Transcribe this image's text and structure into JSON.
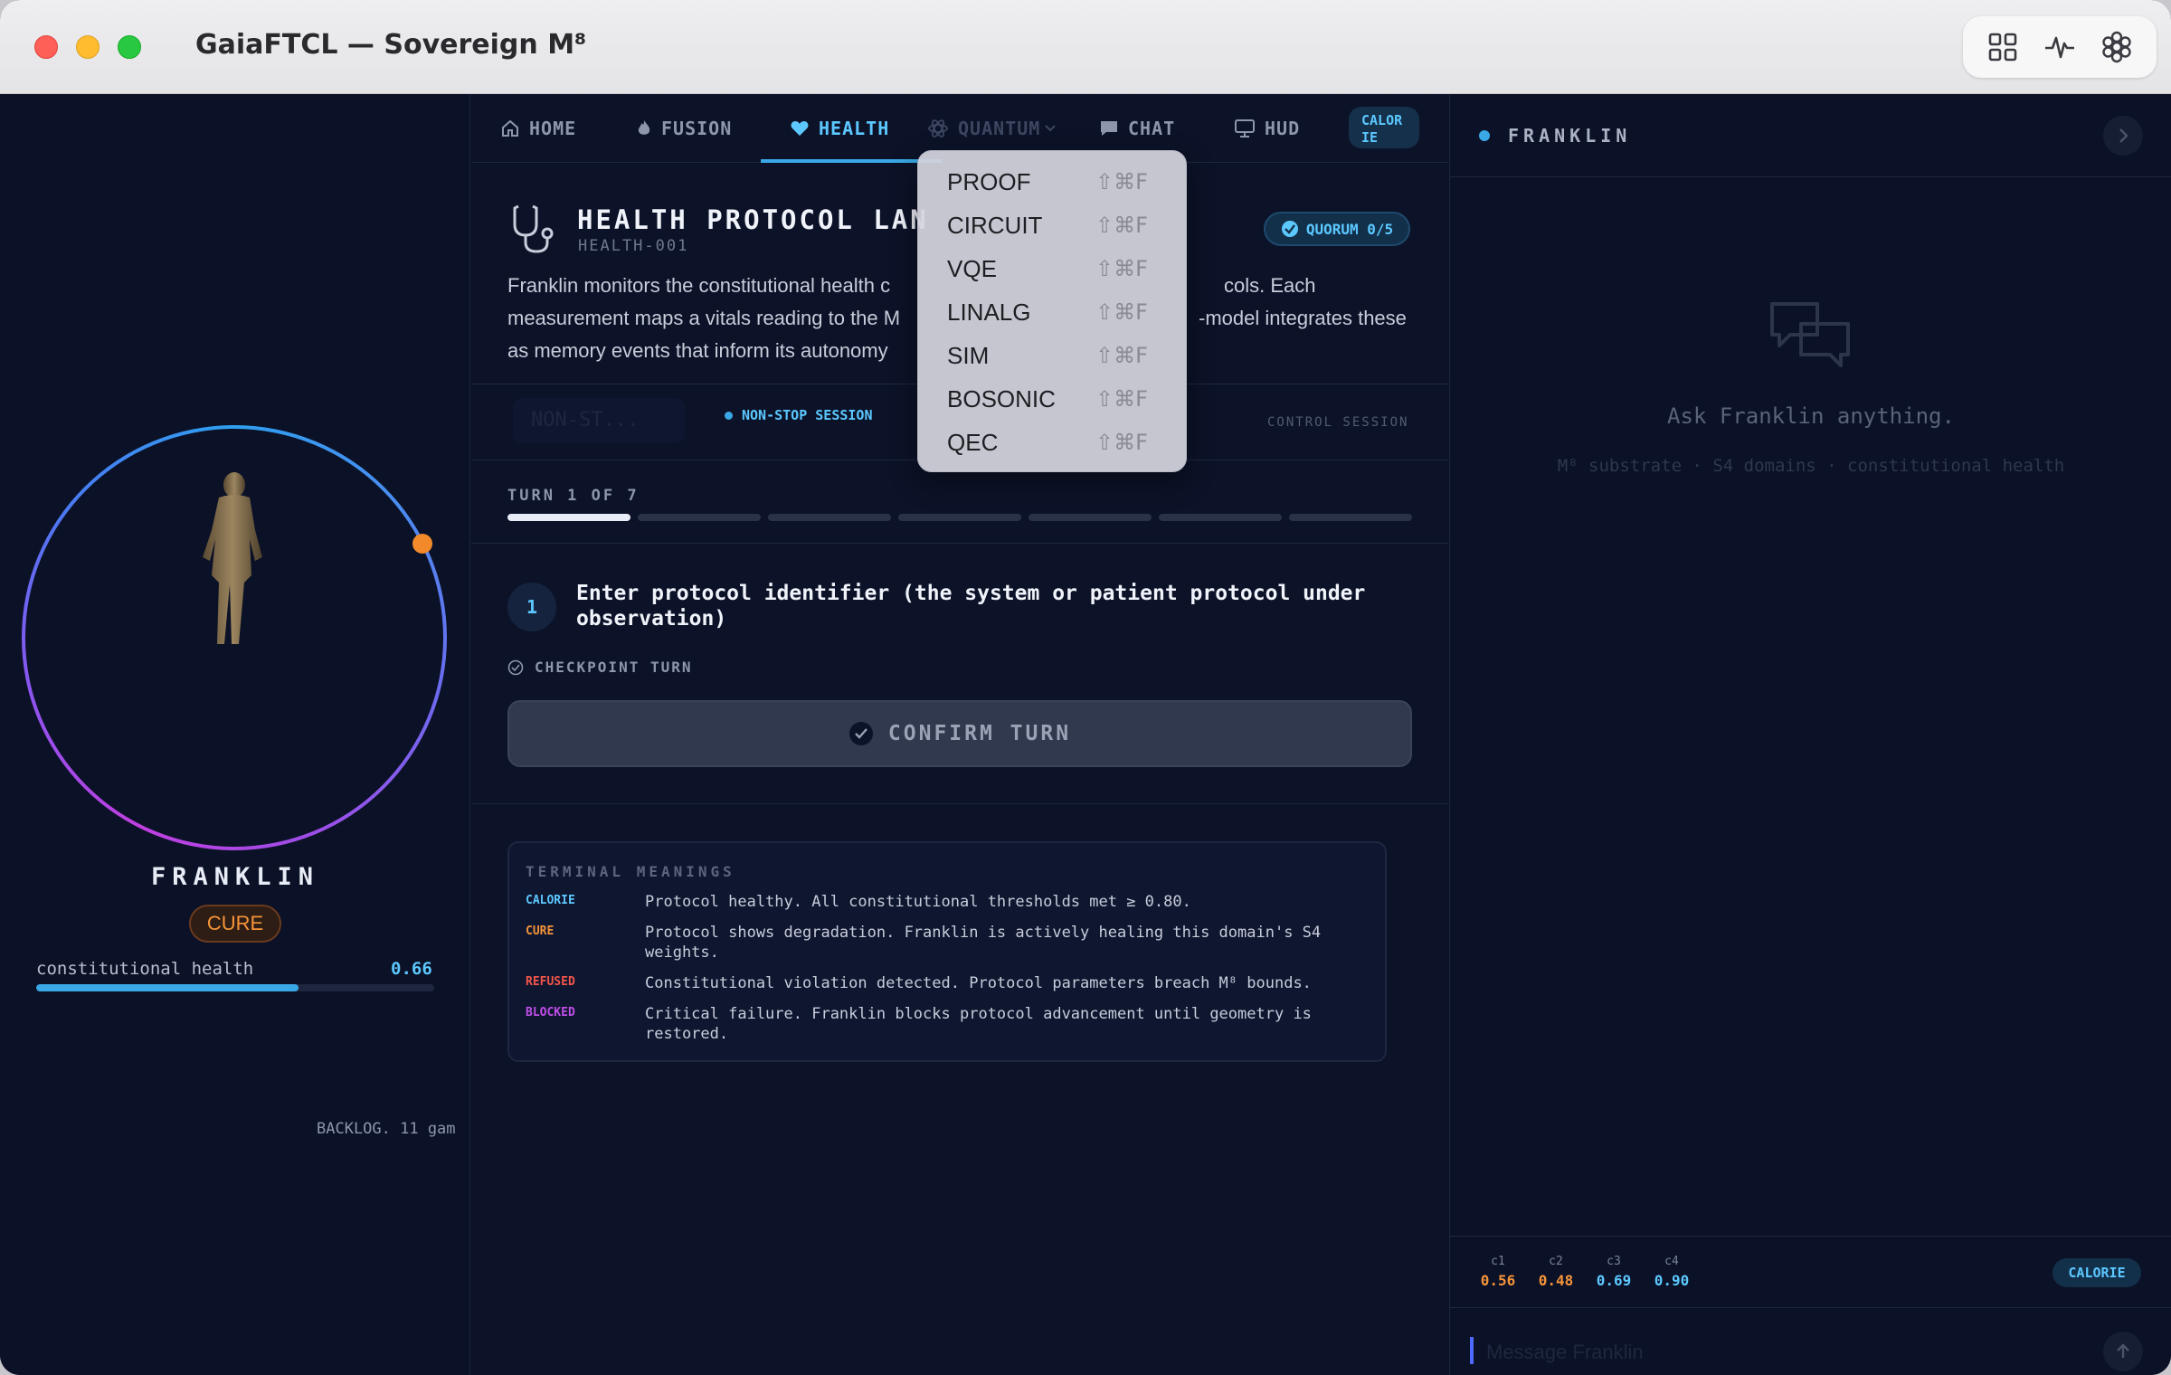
{
  "window": {
    "title": "GaiaFTCL — Sovereign M⁸",
    "toolbar_icons": [
      "grid-icon",
      "pulse-icon",
      "flower-icon"
    ]
  },
  "agent": {
    "name": "FRANKLIN",
    "status": "CURE",
    "health_label": "constitutional health",
    "health_value": "0.66",
    "health_fraction": 0.66,
    "backlog": "BACKLOG. 11 gam"
  },
  "tabs": [
    {
      "label": "HOME",
      "icon": "home-icon"
    },
    {
      "label": "FUSION",
      "icon": "flame-icon"
    },
    {
      "label": "HEALTH",
      "icon": "heart-icon",
      "active": true
    },
    {
      "label": "QUANTUM",
      "icon": "atom-icon"
    },
    {
      "label": "CHAT",
      "icon": "chat-icon"
    },
    {
      "label": "HUD",
      "icon": "monitor-icon"
    }
  ],
  "calorie_tab": {
    "line1": "CALOR",
    "line2": "IE"
  },
  "protocol": {
    "title": "HEALTH PROTOCOL LAN",
    "code": "HEALTH-001",
    "quorum": "QUORUM 0/5",
    "desc_line1_a": "Franklin monitors the constitutional health c",
    "desc_line1_b": "cols. Each",
    "desc_line2_a": "measurement maps a vitals reading to the M",
    "desc_line2_b": "-model integrates these",
    "desc_line3": "as memory events that inform its autonomy"
  },
  "session": {
    "select_value": "NON-ST...",
    "mode": "NON-STOP SESSION",
    "control": "CONTROL SESSION"
  },
  "turn": {
    "label": "TURN 1 OF 7",
    "current": 1,
    "total": 7,
    "step_number": "1",
    "step_text": "Enter protocol identifier (the system or patient protocol under observation)",
    "checkpoint": "CHECKPOINT TURN",
    "confirm": "CONFIRM TURN"
  },
  "meanings": {
    "title": "TERMINAL MEANINGS",
    "items": [
      {
        "key": "CALORIE",
        "color": "#5cc8ff",
        "text": "Protocol healthy. All constitutional thresholds met ≥ 0.80."
      },
      {
        "key": "CURE",
        "color": "#f6943a",
        "text": "Protocol shows degradation. Franklin is actively healing this domain's S4 weights."
      },
      {
        "key": "REFUSED",
        "color": "#f2564a",
        "text": "Constitutional violation detected. Protocol parameters breach M⁸ bounds."
      },
      {
        "key": "BLOCKED",
        "color": "#c04fe8",
        "text": "Critical failure. Franklin blocks protocol advancement until geometry is restored."
      }
    ]
  },
  "quantum_menu": {
    "shortcut": "⇧⌘F",
    "items": [
      "PROOF",
      "CIRCUIT",
      "VQE",
      "LINALG",
      "SIM",
      "BOSONIC",
      "QEC"
    ]
  },
  "chat": {
    "name": "FRANKLIN",
    "prompt": "Ask Franklin anything.",
    "sub": "M⁸ substrate · S4 domains · constitutional health",
    "placeholder": "Message Franklin",
    "metrics": [
      {
        "k": "c1",
        "v": "0.56",
        "color": "#f6943a"
      },
      {
        "k": "c2",
        "v": "0.48",
        "color": "#f6943a"
      },
      {
        "k": "c3",
        "v": "0.69",
        "color": "#5cc8ff"
      },
      {
        "k": "c4",
        "v": "0.90",
        "color": "#5cc8ff"
      }
    ],
    "status_chip": "CALORIE"
  },
  "colors": {
    "accent": "#3aa8e6",
    "cure": "#f6943a",
    "background": "#0b1126"
  }
}
